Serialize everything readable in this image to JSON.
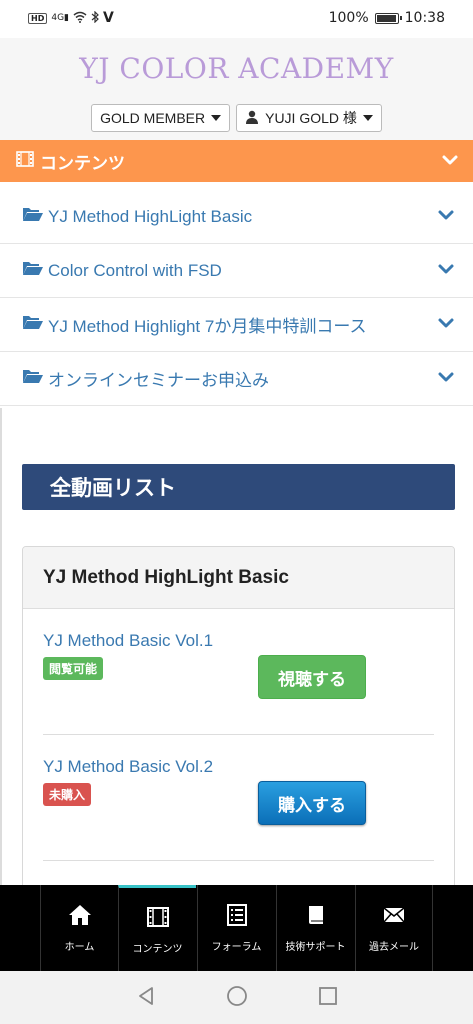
{
  "status": {
    "hd": "HD",
    "signal": "4G",
    "battery_pct": "100%",
    "battery_level": 1.0,
    "time": "10:38"
  },
  "header": {
    "brand": "YJ COLOR ACADEMY",
    "member_label": "GOLD MEMBER",
    "user_label": "YUJI GOLD 様"
  },
  "contents_bar": {
    "label": "コンテンツ"
  },
  "nav": {
    "items": [
      {
        "label": "YJ Method HighLight Basic"
      },
      {
        "label": "Color Control with FSD"
      },
      {
        "label": "YJ Method Highlight 7か月集中特訓コース"
      },
      {
        "label": "オンラインセミナーお申込み"
      }
    ]
  },
  "main": {
    "section_title": "全動画リスト",
    "panel_title": "YJ Method HighLight Basic",
    "videos": [
      {
        "title": "YJ Method Basic Vol.1",
        "badge": "閲覧可能",
        "action": "視聴する"
      },
      {
        "title": "YJ Method Basic Vol.2",
        "badge": "未購入",
        "action": "購入する"
      }
    ]
  },
  "tabbar": {
    "tabs": [
      {
        "label": "ホーム",
        "icon": "home-icon"
      },
      {
        "label": "コンテンツ",
        "icon": "film-icon"
      },
      {
        "label": "フォーラム",
        "icon": "list-icon"
      },
      {
        "label": "技術サポート",
        "icon": "book-icon"
      },
      {
        "label": "過去メール",
        "icon": "envelope-icon"
      }
    ]
  },
  "colors": {
    "brand": "#b99bd8",
    "contents_bar": "#fd964d",
    "link": "#3979b0",
    "section_title": "#2e4a7a",
    "green": "#5cb85c",
    "red": "#d9534f",
    "tab_active": "#38c2c7"
  }
}
